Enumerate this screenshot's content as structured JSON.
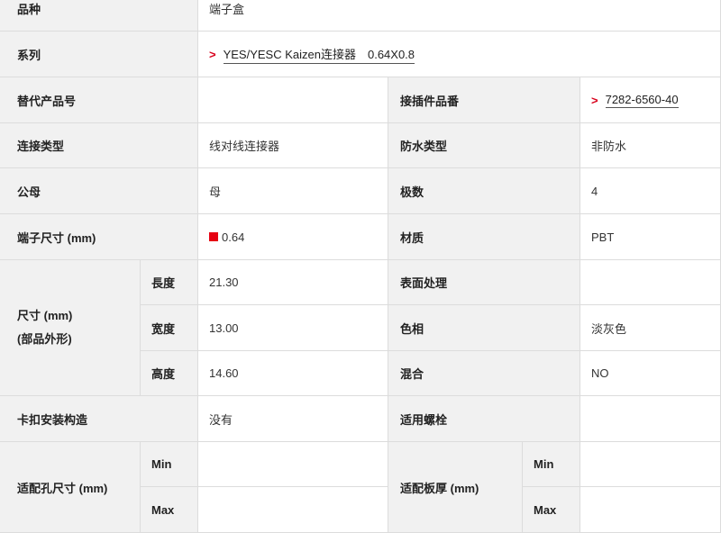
{
  "spec": {
    "product_type": {
      "label": "品种",
      "value": "端子盒"
    },
    "series": {
      "label": "系列",
      "value": "YES/YESC Kaizen连接器　0.64X0.8"
    },
    "alt_part_no": {
      "label": "替代产品号",
      "value": ""
    },
    "mating_part_no": {
      "label": "接插件品番",
      "value": "7282-6560-40"
    },
    "connection_type": {
      "label": "连接类型",
      "value": "线对线连接器"
    },
    "waterproof_type": {
      "label": "防水类型",
      "value": "非防水"
    },
    "gender": {
      "label": "公母",
      "value": "母"
    },
    "poles": {
      "label": "极数",
      "value": "4"
    },
    "terminal_size": {
      "label": "端子尺寸 (mm)",
      "value": "0.64",
      "swatch_color": "#e60012"
    },
    "material": {
      "label": "材质",
      "value": "PBT"
    },
    "dimensions": {
      "label_line1": "尺寸 (mm)",
      "label_line2": "(部品外形)",
      "length": {
        "label": "長度",
        "value": "21.30"
      },
      "width": {
        "label": "宽度",
        "value": "13.00"
      },
      "height": {
        "label": "高度",
        "value": "14.60"
      }
    },
    "surface_treatment": {
      "label": "表面处理",
      "value": ""
    },
    "color": {
      "label": "色相",
      "value": "淡灰色"
    },
    "mixing": {
      "label": "混合",
      "value": "NO"
    },
    "clip_mount": {
      "label": "卡扣安装构造",
      "value": "没有"
    },
    "applicable_bolt": {
      "label": "适用螺栓",
      "value": ""
    },
    "hole_size": {
      "label": "适配孔尺寸 (mm)",
      "min_label": "Min",
      "min_value": "",
      "max_label": "Max",
      "max_value": ""
    },
    "plate_thickness": {
      "label": "适配板厚 (mm)",
      "min_label": "Min",
      "min_value": "",
      "max_label": "Max",
      "max_value": ""
    }
  },
  "colors": {
    "arrow": "#d8001b",
    "label_bg": "#f1f1f1",
    "border": "#dcdcdc"
  },
  "icons": {
    "link_arrow": "chevron-right-icon",
    "swatch": "red-square-icon"
  }
}
